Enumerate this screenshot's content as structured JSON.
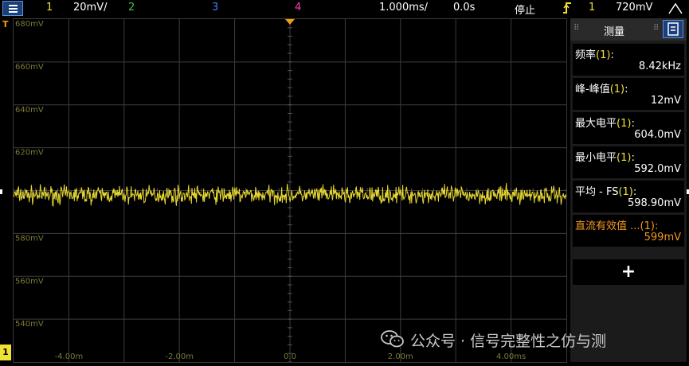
{
  "topbar": {
    "ch1_num": "1",
    "ch1_scale": "20mV/",
    "ch2_num": "2",
    "ch3_num": "3",
    "ch4_num": "4",
    "timebase": "1.000ms/",
    "delay": "0.0s",
    "run_state": "停止",
    "trig_channel": "1",
    "trig_level": "720mV"
  },
  "colors": {
    "ch1": "#f1e135",
    "ch2": "#3ec43e",
    "ch3": "#4a7cff",
    "ch4": "#ff3fb4",
    "trigger": "#f39a1e",
    "highlight": "#f39a1e"
  },
  "graticule": {
    "y_labels": [
      "680mV",
      "660mV",
      "640mV",
      "620mV",
      "600mV",
      "580mV",
      "560mV",
      "540mV"
    ],
    "x_labels": [
      "-4.00m",
      "-2.00m",
      "0.0",
      "2.00m",
      "4.00ms"
    ],
    "ch1_marker": "1",
    "trigger_marker": "T"
  },
  "waveform": {
    "level_mV": 598.9,
    "min_mV": 592.0,
    "max_mV": 604.0
  },
  "side_panel": {
    "title": "测量",
    "measurements": [
      {
        "label": "频率",
        "channel": "(1)",
        "suffix": ":",
        "value": "8.42kHz"
      },
      {
        "label": "峰-峰值",
        "channel": "(1)",
        "suffix": ":",
        "value": "12mV"
      },
      {
        "label": "最大电平",
        "channel": "(1)",
        "suffix": ":",
        "value": "604.0mV"
      },
      {
        "label": "最小电平",
        "channel": "(1)",
        "suffix": ":",
        "value": "592.0mV"
      },
      {
        "label": "平均 - FS",
        "channel": "(1)",
        "suffix": ":",
        "value": "598.90mV"
      },
      {
        "label": "直流有效值 ...",
        "channel": "(1)",
        "suffix": ":",
        "value": "599mV"
      }
    ],
    "add_label": "+"
  },
  "watermark": {
    "text": "公众号 · 信号完整性之仿与测",
    "icon": "wechat-icon"
  }
}
